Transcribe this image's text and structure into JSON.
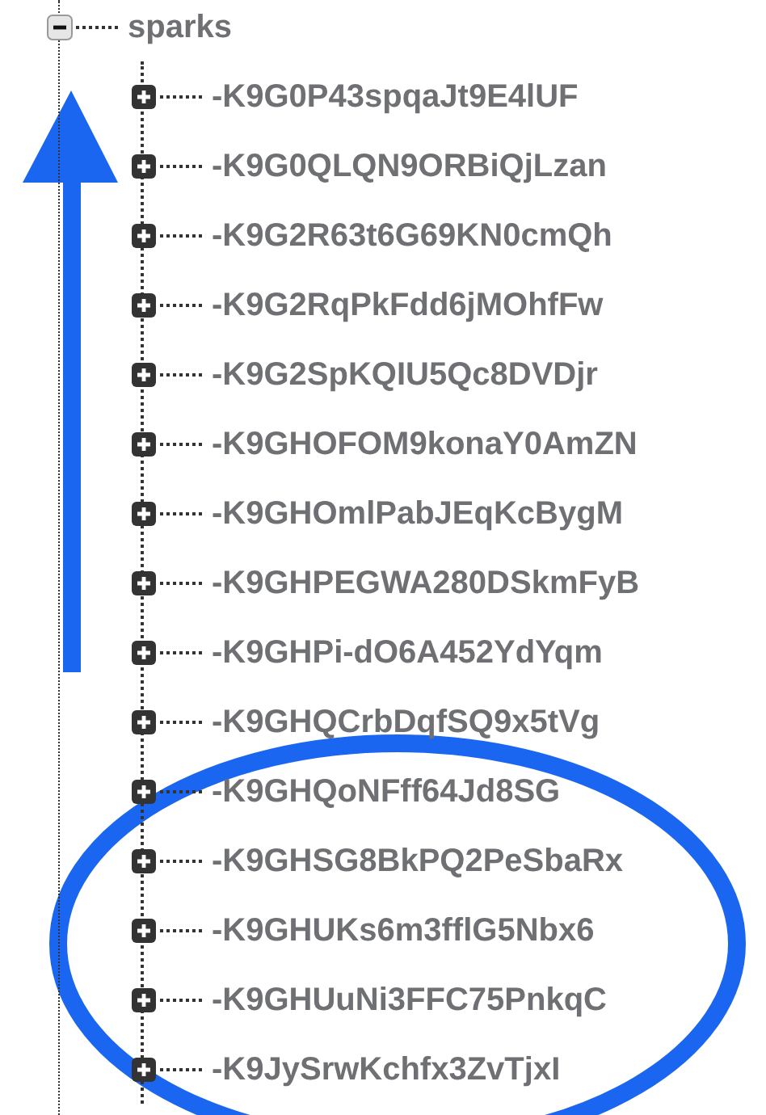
{
  "tree": [
    {
      "label": "sparks",
      "expanded": true,
      "children": [
        {
          "label": "-K9G0P43spqaJt9E4lUF",
          "expanded": false
        },
        {
          "label": "-K9G0QLQN9ORBiQjLzan",
          "expanded": false
        },
        {
          "label": "-K9G2R63t6G69KN0cmQh",
          "expanded": false
        },
        {
          "label": "-K9G2RqPkFdd6jMOhfFw",
          "expanded": false
        },
        {
          "label": "-K9G2SpKQIU5Qc8DVDjr",
          "expanded": false
        },
        {
          "label": "-K9GHOFOM9konaY0AmZN",
          "expanded": false
        },
        {
          "label": "-K9GHOmlPabJEqKcBygM",
          "expanded": false
        },
        {
          "label": "-K9GHPEGWA280DSkmFyB",
          "expanded": false
        },
        {
          "label": "-K9GHPi-dO6A452YdYqm",
          "expanded": false
        },
        {
          "label": "-K9GHQCrbDqfSQ9x5tVg",
          "expanded": false
        },
        {
          "label": "-K9GHQoNFff64Jd8SG",
          "expanded": false
        },
        {
          "label": "-K9GHSG8BkPQ2PeSbaRx",
          "expanded": false
        },
        {
          "label": "-K9GHUKs6m3fflG5Nbx6",
          "expanded": false
        },
        {
          "label": "-K9GHUuNi3FFC75PnkqC",
          "expanded": false
        },
        {
          "label": "-K9JySrwKchfx3ZvTjxI",
          "expanded": false
        }
      ]
    }
  ]
}
